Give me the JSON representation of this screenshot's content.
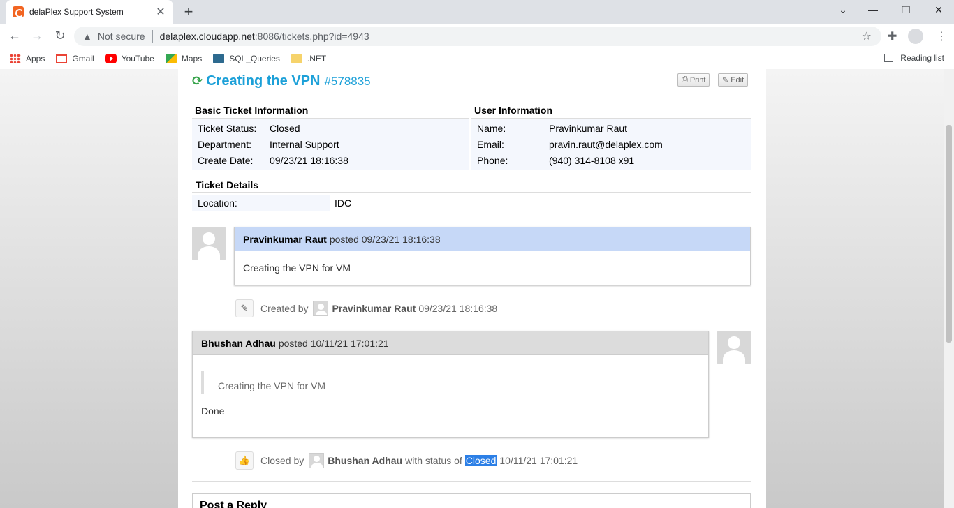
{
  "browser": {
    "tab_title": "delaPlex Support System",
    "not_secure": "Not secure",
    "url_host": "delaplex.cloudapp.net",
    "url_rest": ":8086/tickets.php?id=4943",
    "bookmarks": [
      "Apps",
      "Gmail",
      "YouTube",
      "Maps",
      "SQL_Queries",
      ".NET"
    ],
    "reading_list": "Reading list"
  },
  "ticket": {
    "title": "Creating the VPN",
    "number": "#578835",
    "print_label": "Print",
    "edit_label": "Edit"
  },
  "basic_info": {
    "heading": "Basic Ticket Information",
    "rows": [
      {
        "k": "Ticket Status:",
        "v": "Closed"
      },
      {
        "k": "Department:",
        "v": "Internal Support"
      },
      {
        "k": "Create Date:",
        "v": "09/23/21 18:16:38"
      }
    ]
  },
  "user_info": {
    "heading": "User Information",
    "rows": [
      {
        "k": "Name:",
        "v": "Pravinkumar Raut"
      },
      {
        "k": "Email:",
        "v": "pravin.raut@delaplex.com"
      },
      {
        "k": "Phone:",
        "v": "(940) 314-8108 x91"
      }
    ]
  },
  "details": {
    "heading": "Ticket Details",
    "location_label": "Location:",
    "location_value": "IDC"
  },
  "thread": {
    "post1_author": "Pravinkumar Raut",
    "post1_meta": "posted 09/23/21 18:16:38",
    "post1_body": "Creating the VPN for VM",
    "event1_text": "Created by",
    "event1_author": "Pravinkumar Raut",
    "event1_time": "09/23/21 18:16:38",
    "post2_author": "Bhushan Adhau",
    "post2_meta": "posted 10/11/21 17:01:21",
    "post2_quote": "Creating the VPN for VM",
    "post2_body": "Done",
    "event2_text": "Closed by",
    "event2_author": "Bhushan Adhau",
    "event2_status_text": "with status of",
    "event2_status": "Closed",
    "event2_time": "10/11/21 17:01:21"
  },
  "reply": {
    "heading": "Post a Reply"
  },
  "colors": {
    "accent": "#1ca0d8",
    "customer_post_header": "#c6d8f7",
    "staff_post_header": "#dcdcdc",
    "selection": "#2c7fe6"
  }
}
